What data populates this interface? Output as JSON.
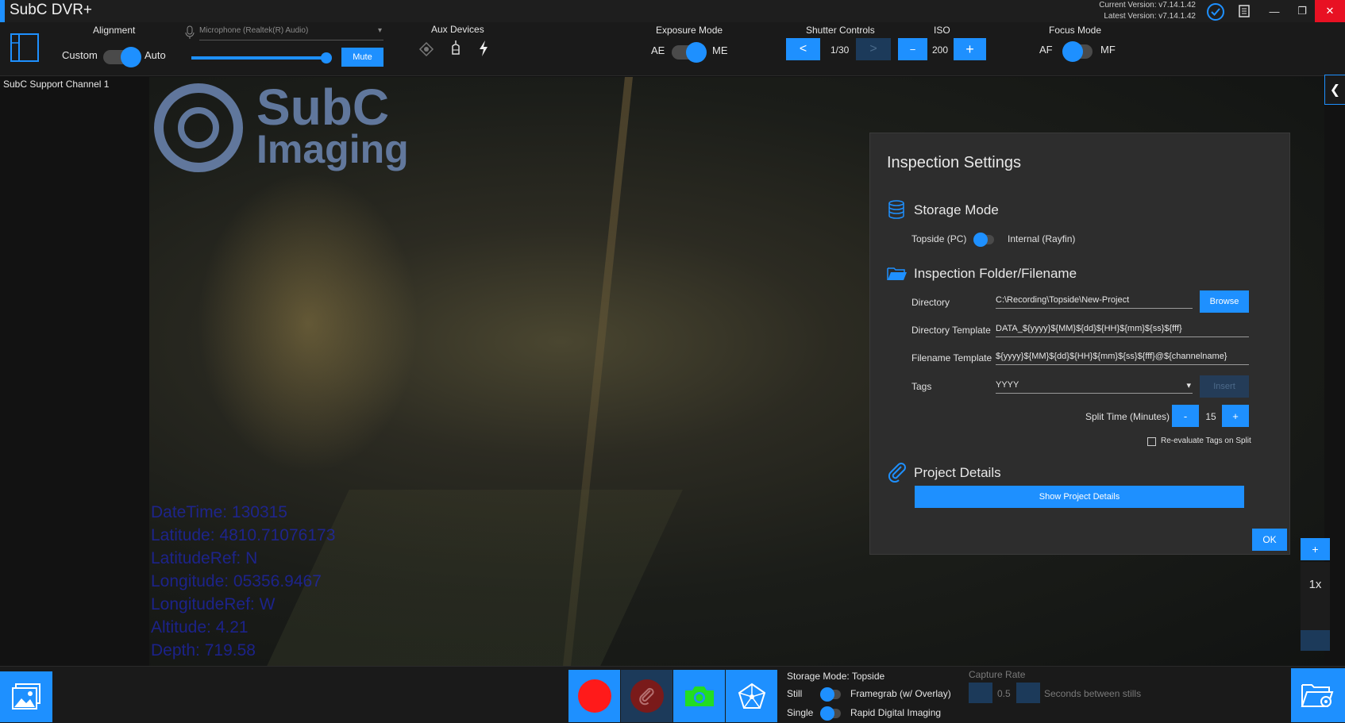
{
  "app": {
    "title": "SubC DVR+",
    "current_version": "Current Version: v7.14.1.42",
    "latest_version": "Latest Version: v7.14.1.42"
  },
  "toolbar": {
    "alignment": {
      "label": "Alignment",
      "left": "Custom",
      "right": "Auto"
    },
    "microphone": {
      "device": "Microphone (Realtek(R) Audio)",
      "mute_label": "Mute",
      "volume": 0.98
    },
    "aux_devices": {
      "label": "Aux Devices"
    },
    "exposure": {
      "label": "Exposure Mode",
      "left": "AE",
      "right": "ME"
    },
    "shutter": {
      "label": "Shutter Controls",
      "prev": "<",
      "value": "1/30",
      "next": ">"
    },
    "iso": {
      "label": "ISO",
      "minus": "−",
      "value": "200",
      "plus": "+"
    },
    "focus": {
      "label": "Focus Mode",
      "left": "AF",
      "right": "MF"
    }
  },
  "video": {
    "channel": "SubC Support Channel 1",
    "logo_line1": "SubC",
    "logo_line2": "Imaging",
    "overlay": [
      "DateTime: 130315",
      "Latitude: 4810.71076173",
      "LatitudeRef: N",
      "Longitude: 05356.9467",
      "LongitudeRef: W",
      "Altitude: 4.21",
      "Depth: 719.58"
    ]
  },
  "panel": {
    "title": "Inspection Settings",
    "storage": {
      "title": "Storage Mode",
      "left": "Topside (PC)",
      "right": "Internal (Rayfin)"
    },
    "folder": {
      "title": "Inspection Folder/Filename",
      "directory_label": "Directory",
      "directory_value": "C:\\Recording\\Topside\\New-Project",
      "browse": "Browse",
      "dir_template_label": "Directory Template",
      "dir_template_value": "DATA_${yyyy}${MM}${dd}${HH}${mm}${ss}${fff}",
      "file_template_label": "Filename Template",
      "file_template_value": "${yyyy}${MM}${dd}${HH}${mm}${ss}${fff}@${channelname}",
      "tags_label": "Tags",
      "tags_value": "YYYY",
      "insert": "Insert",
      "split_label": "Split Time (Minutes)",
      "split_minus": "-",
      "split_value": "15",
      "split_plus": "+",
      "reeval": "Re-evaluate Tags on Split"
    },
    "project": {
      "title": "Project Details",
      "show": "Show Project Details"
    },
    "ok": "OK"
  },
  "zoom": {
    "plus": "+",
    "level": "1x"
  },
  "bottom": {
    "storage_mode": "Storage Mode: Topside",
    "still": "Still",
    "framegrab": "Framegrab (w/ Overlay)",
    "single": "Single",
    "rdi": "Rapid Digital Imaging",
    "capture_rate": "Capture Rate",
    "rate_value": "0.5",
    "rate_unit": "Seconds between stills"
  },
  "colors": {
    "accent": "#1e90ff",
    "record": "#ff1a1a",
    "camera": "#22dd22",
    "close": "#e81123"
  }
}
